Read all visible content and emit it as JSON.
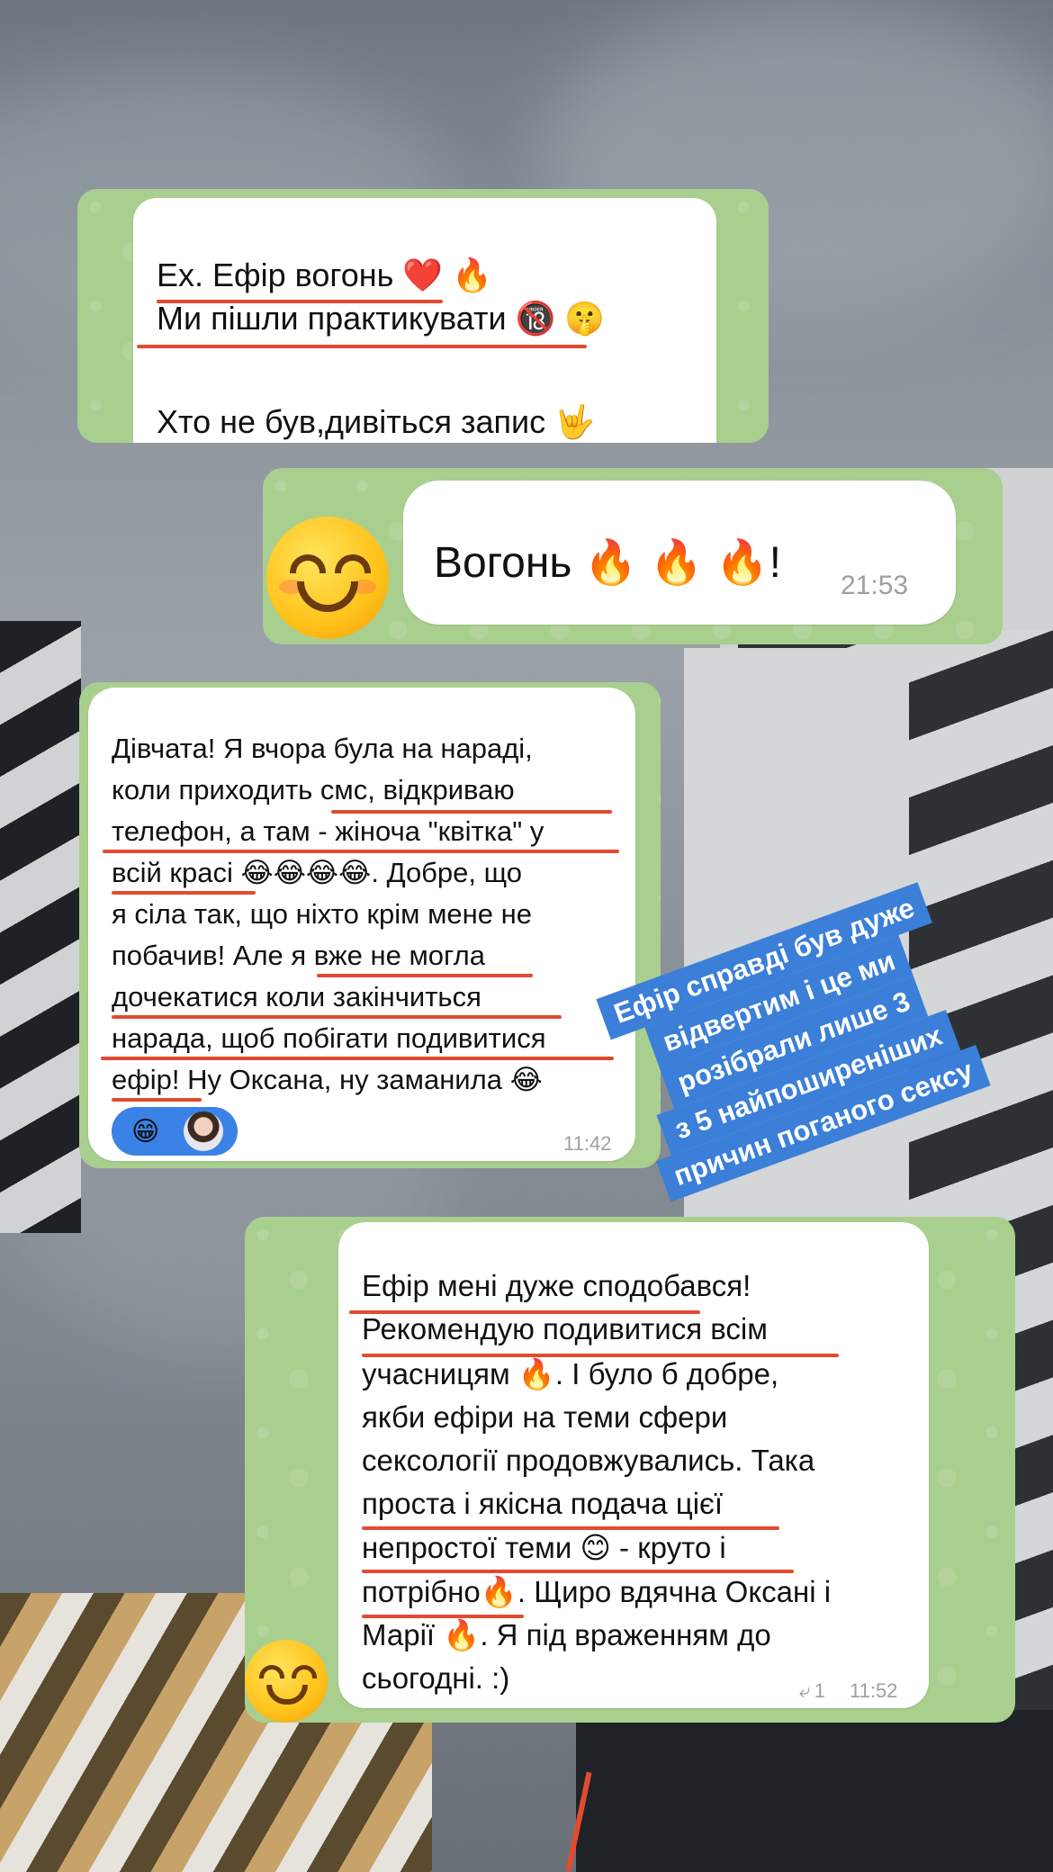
{
  "messages": [
    {
      "lines": [
        "Ех. Ефір вогонь ❤️ 🔥",
        "Ми пішли практикувати 🔞 🤫",
        "Хто не був,дивіться запис 🤟"
      ]
    },
    {
      "text": "Вогонь 🔥 🔥 🔥!",
      "time": "21:53",
      "avatar": "smiling-face"
    },
    {
      "lines": [
        "Дівчата! Я вчора була на нараді,",
        "коли приходить смс, відкриваю",
        "телефон, а там - жіноча \"квітка\" у",
        "всій красі 😂😂😂😂. Добре, що",
        "я сіла так, що ніхто крім мене не",
        "побачив! Але я вже не могла",
        "дочекатися коли закінчиться",
        "нарада, щоб побігати подивитися",
        "ефір! Ну Оксана, ну заманила 😂"
      ],
      "reaction": "😁",
      "time": "11:42"
    },
    {
      "lines": [
        "Ефір мені дуже сподобався!",
        "Рекомендую подивитися всім",
        "учасницям 🔥. І було б добре,",
        "якби ефіри на теми сфери",
        "сексології продовжувались. Така",
        "проста і якісна подача цієї",
        "непростої теми 😊 - круто і",
        "потрібно🔥. Щиро вдячна Оксані і",
        "Марії 🔥. Я під враженням до",
        "сьогодні. :)"
      ],
      "reply_count": "1",
      "time": "11:52",
      "avatar": "smiling-face"
    }
  ],
  "sticker": {
    "lines": [
      "Ефір справді був дуже",
      "відвертим і це ми",
      "розібрали лише 3",
      "з 5 найпоширеніших",
      "причин поганого сексу"
    ],
    "color": "#3b7fd8"
  },
  "colors": {
    "bubble_bg": "#a9cf8f",
    "underline": "#e24b2f"
  }
}
